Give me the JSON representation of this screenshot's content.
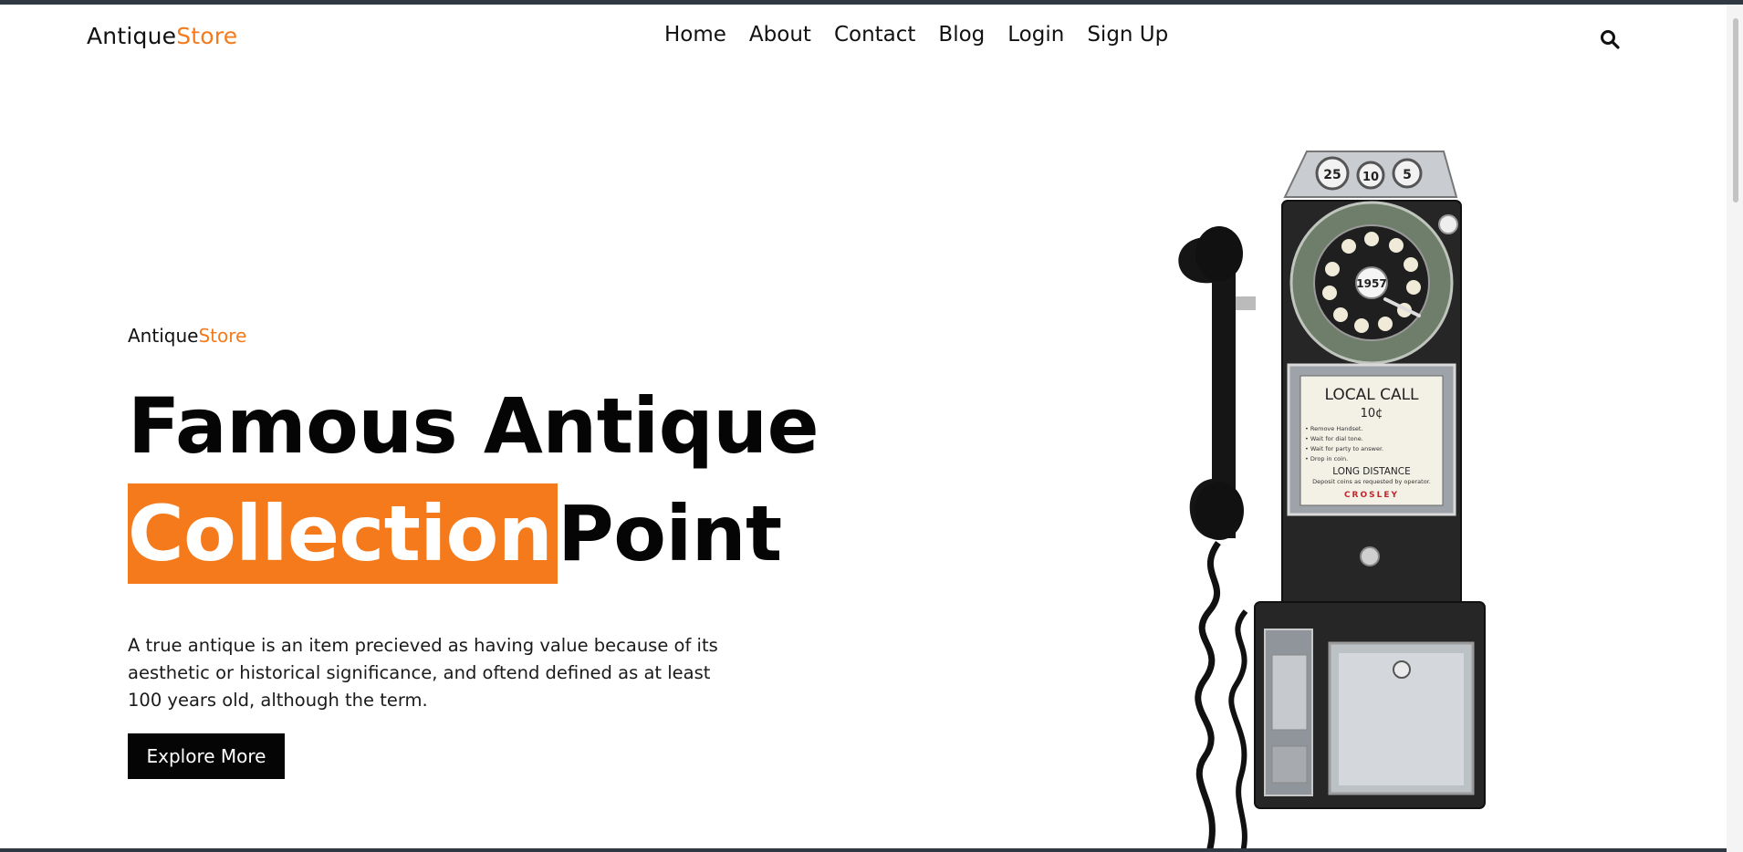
{
  "brand": {
    "part1": "Antique",
    "part2": "Store",
    "accent": "#f57a1c"
  },
  "nav": [
    {
      "label": "Home"
    },
    {
      "label": "About"
    },
    {
      "label": "Contact"
    },
    {
      "label": "Blog"
    },
    {
      "label": "Login"
    },
    {
      "label": "Sign Up"
    }
  ],
  "header": {
    "search_icon": "search-icon"
  },
  "hero": {
    "eyebrow_part1": "Antique",
    "eyebrow_part2": "Store",
    "title_line1": "Famous Antique",
    "title_highlight": "Collection",
    "title_end": "Point",
    "description": "A true antique is an item precieved as having value because of its aesthetic or historical significance, and oftend defined as at least 100 years old, although the term.",
    "button_label": "Explore More"
  },
  "phone": {
    "coin_labels": [
      "25",
      "10",
      "5"
    ],
    "dial_center": "1957",
    "card_title": "LOCAL CALL",
    "card_price": "10¢",
    "card_lines": [
      "• Remove Handset.",
      "• Wait for dial tone.",
      "• Wait for party to answer.",
      "• Drop in coin."
    ],
    "card_footer": "LONG DISTANCE",
    "card_sub": "Deposit coins as requested by operator.",
    "card_brand": "CROSLEY"
  }
}
